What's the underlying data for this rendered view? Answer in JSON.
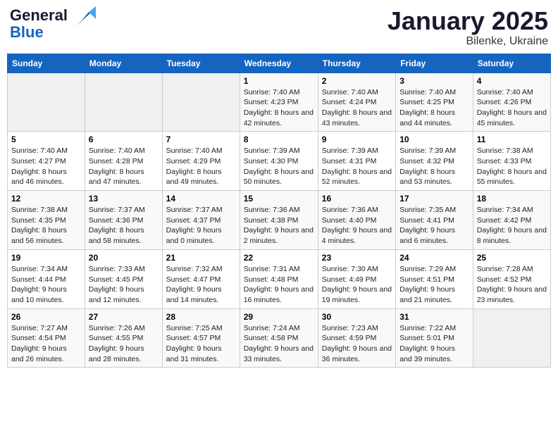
{
  "header": {
    "logo_line1": "General",
    "logo_line2": "Blue",
    "month_title": "January 2025",
    "subtitle": "Bilenke, Ukraine"
  },
  "days_of_week": [
    "Sunday",
    "Monday",
    "Tuesday",
    "Wednesday",
    "Thursday",
    "Friday",
    "Saturday"
  ],
  "weeks": [
    [
      {
        "day": "",
        "info": ""
      },
      {
        "day": "",
        "info": ""
      },
      {
        "day": "",
        "info": ""
      },
      {
        "day": "1",
        "info": "Sunrise: 7:40 AM\nSunset: 4:23 PM\nDaylight: 8 hours and 42 minutes."
      },
      {
        "day": "2",
        "info": "Sunrise: 7:40 AM\nSunset: 4:24 PM\nDaylight: 8 hours and 43 minutes."
      },
      {
        "day": "3",
        "info": "Sunrise: 7:40 AM\nSunset: 4:25 PM\nDaylight: 8 hours and 44 minutes."
      },
      {
        "day": "4",
        "info": "Sunrise: 7:40 AM\nSunset: 4:26 PM\nDaylight: 8 hours and 45 minutes."
      }
    ],
    [
      {
        "day": "5",
        "info": "Sunrise: 7:40 AM\nSunset: 4:27 PM\nDaylight: 8 hours and 46 minutes."
      },
      {
        "day": "6",
        "info": "Sunrise: 7:40 AM\nSunset: 4:28 PM\nDaylight: 8 hours and 47 minutes."
      },
      {
        "day": "7",
        "info": "Sunrise: 7:40 AM\nSunset: 4:29 PM\nDaylight: 8 hours and 49 minutes."
      },
      {
        "day": "8",
        "info": "Sunrise: 7:39 AM\nSunset: 4:30 PM\nDaylight: 8 hours and 50 minutes."
      },
      {
        "day": "9",
        "info": "Sunrise: 7:39 AM\nSunset: 4:31 PM\nDaylight: 8 hours and 52 minutes."
      },
      {
        "day": "10",
        "info": "Sunrise: 7:39 AM\nSunset: 4:32 PM\nDaylight: 8 hours and 53 minutes."
      },
      {
        "day": "11",
        "info": "Sunrise: 7:38 AM\nSunset: 4:33 PM\nDaylight: 8 hours and 55 minutes."
      }
    ],
    [
      {
        "day": "12",
        "info": "Sunrise: 7:38 AM\nSunset: 4:35 PM\nDaylight: 8 hours and 56 minutes."
      },
      {
        "day": "13",
        "info": "Sunrise: 7:37 AM\nSunset: 4:36 PM\nDaylight: 8 hours and 58 minutes."
      },
      {
        "day": "14",
        "info": "Sunrise: 7:37 AM\nSunset: 4:37 PM\nDaylight: 9 hours and 0 minutes."
      },
      {
        "day": "15",
        "info": "Sunrise: 7:36 AM\nSunset: 4:38 PM\nDaylight: 9 hours and 2 minutes."
      },
      {
        "day": "16",
        "info": "Sunrise: 7:36 AM\nSunset: 4:40 PM\nDaylight: 9 hours and 4 minutes."
      },
      {
        "day": "17",
        "info": "Sunrise: 7:35 AM\nSunset: 4:41 PM\nDaylight: 9 hours and 6 minutes."
      },
      {
        "day": "18",
        "info": "Sunrise: 7:34 AM\nSunset: 4:42 PM\nDaylight: 9 hours and 8 minutes."
      }
    ],
    [
      {
        "day": "19",
        "info": "Sunrise: 7:34 AM\nSunset: 4:44 PM\nDaylight: 9 hours and 10 minutes."
      },
      {
        "day": "20",
        "info": "Sunrise: 7:33 AM\nSunset: 4:45 PM\nDaylight: 9 hours and 12 minutes."
      },
      {
        "day": "21",
        "info": "Sunrise: 7:32 AM\nSunset: 4:47 PM\nDaylight: 9 hours and 14 minutes."
      },
      {
        "day": "22",
        "info": "Sunrise: 7:31 AM\nSunset: 4:48 PM\nDaylight: 9 hours and 16 minutes."
      },
      {
        "day": "23",
        "info": "Sunrise: 7:30 AM\nSunset: 4:49 PM\nDaylight: 9 hours and 19 minutes."
      },
      {
        "day": "24",
        "info": "Sunrise: 7:29 AM\nSunset: 4:51 PM\nDaylight: 9 hours and 21 minutes."
      },
      {
        "day": "25",
        "info": "Sunrise: 7:28 AM\nSunset: 4:52 PM\nDaylight: 9 hours and 23 minutes."
      }
    ],
    [
      {
        "day": "26",
        "info": "Sunrise: 7:27 AM\nSunset: 4:54 PM\nDaylight: 9 hours and 26 minutes."
      },
      {
        "day": "27",
        "info": "Sunrise: 7:26 AM\nSunset: 4:55 PM\nDaylight: 9 hours and 28 minutes."
      },
      {
        "day": "28",
        "info": "Sunrise: 7:25 AM\nSunset: 4:57 PM\nDaylight: 9 hours and 31 minutes."
      },
      {
        "day": "29",
        "info": "Sunrise: 7:24 AM\nSunset: 4:58 PM\nDaylight: 9 hours and 33 minutes."
      },
      {
        "day": "30",
        "info": "Sunrise: 7:23 AM\nSunset: 4:59 PM\nDaylight: 9 hours and 36 minutes."
      },
      {
        "day": "31",
        "info": "Sunrise: 7:22 AM\nSunset: 5:01 PM\nDaylight: 9 hours and 39 minutes."
      },
      {
        "day": "",
        "info": ""
      }
    ]
  ]
}
